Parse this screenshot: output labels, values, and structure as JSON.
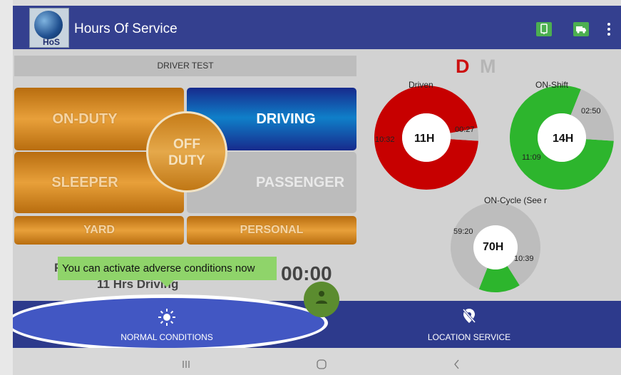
{
  "app": {
    "title": "Hours Of Service",
    "logo_text": "HoS"
  },
  "driver": {
    "name": "DRIVER TEST"
  },
  "status_buttons": {
    "on_duty": "ON-DUTY",
    "driving": "DRIVING",
    "off_duty_line1": "OFF",
    "off_duty_line2": "DUTY",
    "sleeper": "SLEEPER",
    "passenger": "PASSENGER",
    "yard": "YARD",
    "personal": "PERSONAL"
  },
  "mode": {
    "d": "D",
    "m": "M"
  },
  "gauges": {
    "driven": {
      "label": "Driven",
      "center": "11H",
      "left_value": "10:32",
      "right_value": "00:27",
      "used_fraction": 0.96
    },
    "on_shift": {
      "label": "ON-Shift",
      "center": "14H",
      "top_value": "02:50",
      "bottom_value": "11:09",
      "used_fraction": 0.2
    },
    "on_cycle": {
      "label": "ON-Cycle (See r",
      "center": "70H",
      "left_value": "59:20",
      "right_value": "10:39",
      "used_fraction": 0.85
    }
  },
  "status_text": {
    "partial_label": "F",
    "driving_hint": "11 Hrs Driving",
    "timer": "00:00"
  },
  "tooltip": {
    "text": "You can activate adverse conditions now"
  },
  "bottom_tabs": {
    "normal_conditions": "NORMAL CONDITIONS",
    "location_service": "LOCATION SERVICE"
  },
  "icons": {
    "sun": "sun-icon",
    "location_off": "location-off-icon",
    "tablet": "tablet-icon",
    "truck": "truck-icon",
    "menu": "more-vert-icon"
  },
  "colors": {
    "accent": "#34408f",
    "driven": "#c70000",
    "on_shift": "#2db52d",
    "on_cycle": "#2db52d",
    "remaining": "#bdbdbd"
  }
}
